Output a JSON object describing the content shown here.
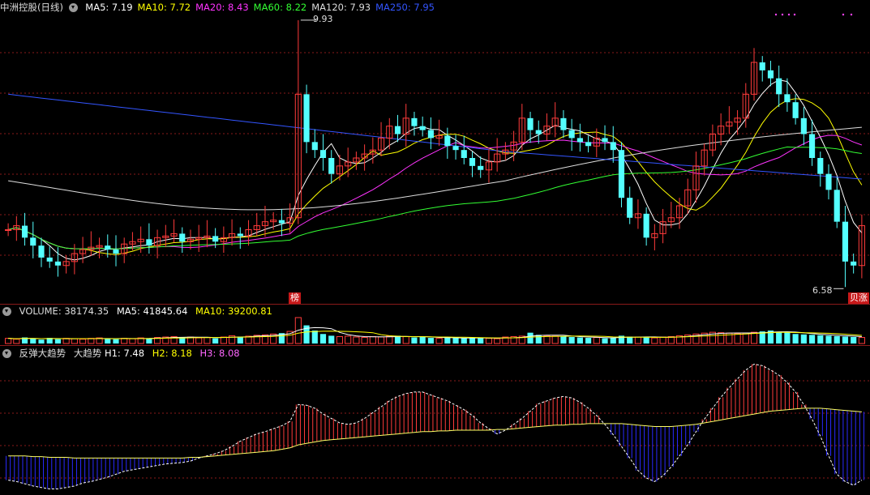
{
  "header": {
    "stock": "中洲控股(日线)",
    "ma_labels": [
      {
        "text": "MA5: 7.19",
        "color": "#ffffff"
      },
      {
        "text": "MA10: 7.72",
        "color": "#ffff00"
      },
      {
        "text": "MA20: 8.43",
        "color": "#ff33ff"
      },
      {
        "text": "MA60: 8.22",
        "color": "#33ff33"
      },
      {
        "text": "MA120: 7.93",
        "color": "#dddddd"
      },
      {
        "text": "MA250: 7.95",
        "color": "#3355ff"
      }
    ]
  },
  "volume_header": {
    "title": "VOLUME: 38174.35",
    "ma5": "MA5: 41845.64",
    "ma10": "MA10: 39200.81"
  },
  "indicator_header": {
    "name": "反弹大趋势",
    "sub": "大趋势",
    "h1": "H1: 7.48",
    "h2": "H2: 8.18",
    "h3": "H3: 8.08"
  },
  "markers": {
    "high_label": "9.93",
    "low_label": "6.58",
    "bang_tag": "榜",
    "right_tag": "贝涨"
  },
  "colors": {
    "up": "#ff3b3b",
    "down": "#54ffff",
    "grid": "#8a1a1a",
    "indicator_up": "#ff3b3b",
    "indicator_down": "#2a2aff",
    "h_line": "#ffff66"
  },
  "chart_data": {
    "type": "candlestick",
    "y_range": [
      6.4,
      10.0
    ],
    "series": [
      {
        "name": "MA5",
        "value": 7.19
      },
      {
        "name": "MA10",
        "value": 7.72
      },
      {
        "name": "MA20",
        "value": 8.43
      },
      {
        "name": "MA60",
        "value": 8.22
      },
      {
        "name": "MA120",
        "value": 7.93
      },
      {
        "name": "MA250",
        "value": 7.95
      }
    ],
    "high": 9.93,
    "low": 6.58,
    "closes": [
      7.3,
      7.35,
      7.2,
      7.1,
      6.95,
      6.9,
      6.85,
      6.9,
      7.0,
      7.05,
      7.08,
      7.1,
      7.05,
      7.0,
      7.12,
      7.15,
      7.18,
      7.1,
      7.2,
      7.22,
      7.25,
      7.15,
      7.18,
      7.2,
      7.22,
      7.15,
      7.2,
      7.25,
      7.22,
      7.3,
      7.35,
      7.4,
      7.42,
      7.38,
      7.45,
      9.0,
      8.4,
      8.3,
      8.2,
      8.0,
      8.1,
      8.15,
      8.2,
      8.25,
      8.3,
      8.45,
      8.6,
      8.5,
      8.7,
      8.6,
      8.55,
      8.45,
      8.48,
      8.35,
      8.3,
      8.2,
      8.1,
      8.05,
      8.15,
      8.25,
      8.3,
      8.4,
      8.7,
      8.55,
      8.5,
      8.6,
      8.7,
      8.55,
      8.45,
      8.4,
      8.35,
      8.45,
      8.4,
      8.3,
      7.7,
      7.45,
      7.5,
      7.2,
      7.25,
      7.4,
      7.45,
      7.6,
      7.8,
      8.1,
      8.3,
      8.5,
      8.6,
      8.65,
      8.7,
      9.0,
      9.4,
      9.3,
      9.2,
      9.0,
      8.9,
      8.7,
      8.5,
      8.2,
      8.0,
      7.8,
      7.4,
      6.9,
      6.85,
      7.35
    ]
  },
  "volume_data": {
    "values": [
      12,
      10,
      14,
      11,
      9,
      13,
      10,
      12,
      11,
      10,
      12,
      13,
      11,
      10,
      12,
      11,
      13,
      12,
      14,
      15,
      16,
      14,
      15,
      13,
      14,
      12,
      15,
      18,
      16,
      17,
      19,
      20,
      22,
      24,
      28,
      60,
      42,
      30,
      22,
      18,
      16,
      17,
      15,
      14,
      16,
      15,
      17,
      18,
      16,
      14,
      15,
      13,
      12,
      14,
      13,
      12,
      14,
      13,
      12,
      11,
      15,
      16,
      17,
      25,
      20,
      18,
      17,
      16,
      15,
      14,
      13,
      14,
      12,
      13,
      18,
      16,
      15,
      14,
      13,
      15,
      16,
      18,
      20,
      22,
      24,
      26,
      25,
      24,
      23,
      24,
      26,
      28,
      30,
      27,
      25,
      22,
      21,
      20,
      19,
      18,
      17,
      16,
      15,
      14
    ]
  },
  "indicator_data": {
    "histogram": [
      -0.28,
      -0.3,
      -0.33,
      -0.36,
      -0.38,
      -0.4,
      -0.4,
      -0.38,
      -0.36,
      -0.32,
      -0.3,
      -0.27,
      -0.24,
      -0.2,
      -0.16,
      -0.14,
      -0.12,
      -0.1,
      -0.08,
      -0.06,
      -0.05,
      -0.04,
      -0.02,
      0.02,
      0.05,
      0.08,
      0.12,
      0.18,
      0.25,
      0.3,
      0.35,
      0.38,
      0.42,
      0.46,
      0.52,
      0.75,
      0.74,
      0.7,
      0.62,
      0.56,
      0.5,
      0.48,
      0.5,
      0.56,
      0.64,
      0.72,
      0.8,
      0.86,
      0.9,
      0.92,
      0.92,
      0.88,
      0.84,
      0.8,
      0.74,
      0.68,
      0.6,
      0.5,
      0.42,
      0.35,
      0.4,
      0.48,
      0.56,
      0.66,
      0.76,
      0.8,
      0.84,
      0.86,
      0.84,
      0.78,
      0.7,
      0.6,
      0.48,
      0.34,
      0.18,
      0.02,
      -0.15,
      -0.25,
      -0.3,
      -0.22,
      -0.1,
      0.05,
      0.2,
      0.38,
      0.55,
      0.7,
      0.85,
      0.98,
      1.1,
      1.22,
      1.3,
      1.28,
      1.22,
      1.15,
      1.05,
      0.92,
      0.75,
      0.55,
      0.32,
      0.05,
      -0.2,
      -0.3,
      -0.35,
      -0.28
    ],
    "h_line": [
      0.05,
      0.05,
      0.05,
      0.04,
      0.04,
      0.03,
      0.03,
      0.03,
      0.02,
      0.02,
      0.02,
      0.02,
      0.02,
      0.02,
      0.02,
      0.02,
      0.02,
      0.02,
      0.02,
      0.02,
      0.02,
      0.02,
      0.03,
      0.03,
      0.04,
      0.05,
      0.06,
      0.07,
      0.08,
      0.09,
      0.1,
      0.11,
      0.12,
      0.14,
      0.16,
      0.2,
      0.22,
      0.24,
      0.26,
      0.27,
      0.28,
      0.29,
      0.3,
      0.31,
      0.32,
      0.33,
      0.34,
      0.35,
      0.36,
      0.37,
      0.38,
      0.38,
      0.39,
      0.39,
      0.4,
      0.4,
      0.4,
      0.4,
      0.4,
      0.41,
      0.41,
      0.42,
      0.43,
      0.44,
      0.45,
      0.46,
      0.47,
      0.47,
      0.48,
      0.48,
      0.49,
      0.49,
      0.49,
      0.49,
      0.49,
      0.48,
      0.47,
      0.46,
      0.45,
      0.45,
      0.45,
      0.46,
      0.47,
      0.48,
      0.5,
      0.52,
      0.54,
      0.56,
      0.58,
      0.6,
      0.62,
      0.64,
      0.66,
      0.67,
      0.68,
      0.69,
      0.7,
      0.7,
      0.7,
      0.69,
      0.68,
      0.67,
      0.66,
      0.65
    ]
  }
}
